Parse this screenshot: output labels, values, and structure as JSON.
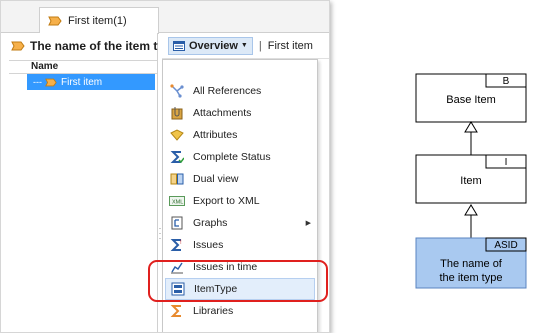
{
  "tab": {
    "title": "First item(1)"
  },
  "left_panel": {
    "title": "The name of the item ty",
    "column_header": "Name",
    "selected_row": "First item"
  },
  "right_panel": {
    "view_button": "Overview",
    "breadcrumb_sep": "|",
    "breadcrumb": "First item"
  },
  "menu": {
    "items": [
      {
        "label": "All References",
        "icon": "references-icon"
      },
      {
        "label": "Attachments",
        "icon": "attachments-icon"
      },
      {
        "label": "Attributes",
        "icon": "attributes-icon"
      },
      {
        "label": "Complete Status",
        "icon": "complete-status-icon"
      },
      {
        "label": "Dual view",
        "icon": "dual-view-icon"
      },
      {
        "label": "Export to XML",
        "icon": "export-xml-icon"
      },
      {
        "label": "Graphs",
        "icon": "graphs-icon",
        "submenu": true
      },
      {
        "label": "Issues",
        "icon": "issues-icon"
      },
      {
        "label": "Issues in time",
        "icon": "issues-time-icon"
      },
      {
        "label": "ItemType",
        "icon": "itemtype-icon",
        "highlighted": true
      },
      {
        "label": "Libraries",
        "icon": "libraries-icon"
      }
    ]
  },
  "diagram": {
    "boxes": [
      {
        "label": "Base Item",
        "tag": "B"
      },
      {
        "label": "Item",
        "tag": "I"
      },
      {
        "label_line1": "The name of",
        "label_line2": "the item type",
        "tag": "ASID"
      }
    ],
    "colors": {
      "highlight_fill": "#a9c9f0",
      "highlight_stroke": "#5a84c0"
    }
  },
  "colors": {
    "selection": "#3399ff",
    "annotation": "#e0201e"
  }
}
